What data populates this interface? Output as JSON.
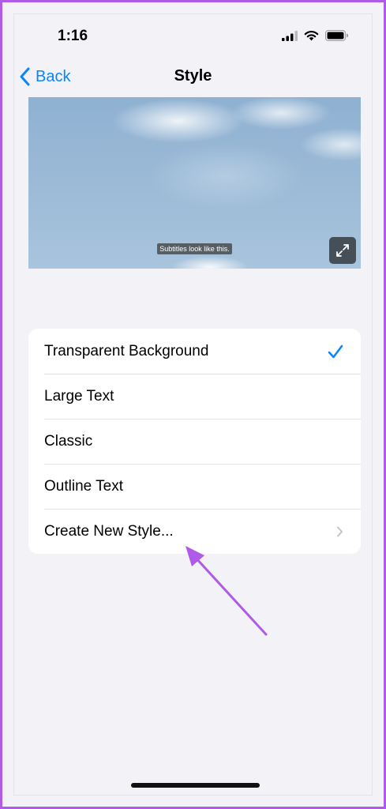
{
  "status_bar": {
    "time": "1:16",
    "icons": [
      "signal-icon",
      "wifi-icon",
      "battery-icon"
    ]
  },
  "nav": {
    "back_label": "Back",
    "title": "Style"
  },
  "preview": {
    "subtitle_text": "Subtitles look like this.",
    "expand_icon": "expand-icon"
  },
  "styles": {
    "items": [
      {
        "label": "Transparent Background",
        "selected": true
      },
      {
        "label": "Large Text",
        "selected": false
      },
      {
        "label": "Classic",
        "selected": false
      },
      {
        "label": "Outline Text",
        "selected": false
      },
      {
        "label": "Create New Style...",
        "disclosure": true
      }
    ]
  },
  "colors": {
    "accent": "#0a84ff",
    "background": "#f2f2f7",
    "annotation": "#b05be8"
  }
}
